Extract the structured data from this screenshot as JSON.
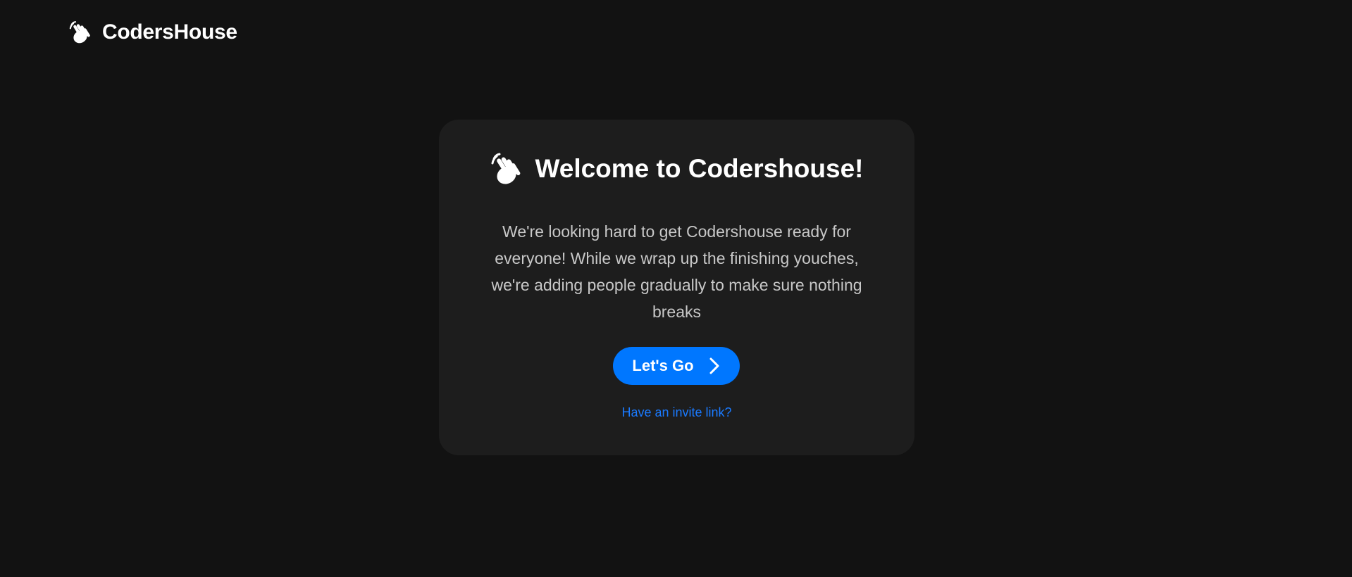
{
  "navbar": {
    "brand": "CodersHouse",
    "logo_icon": "waving-hand-icon"
  },
  "card": {
    "icon": "waving-hand-icon",
    "title": "Welcome to Codershouse!",
    "description": "We're looking hard to get Codershouse ready for everyone! While we wrap up the finishing youches, we're adding people gradually to make sure nothing breaks",
    "button_label": "Let's Go",
    "button_icon": "chevron-right-icon",
    "invite_link": "Have an invite link?"
  },
  "colors": {
    "background": "#121212",
    "card": "#1d1d1d",
    "accent": "#0077ff",
    "link": "#1a7aff",
    "body_text": "#c8c8c8"
  }
}
